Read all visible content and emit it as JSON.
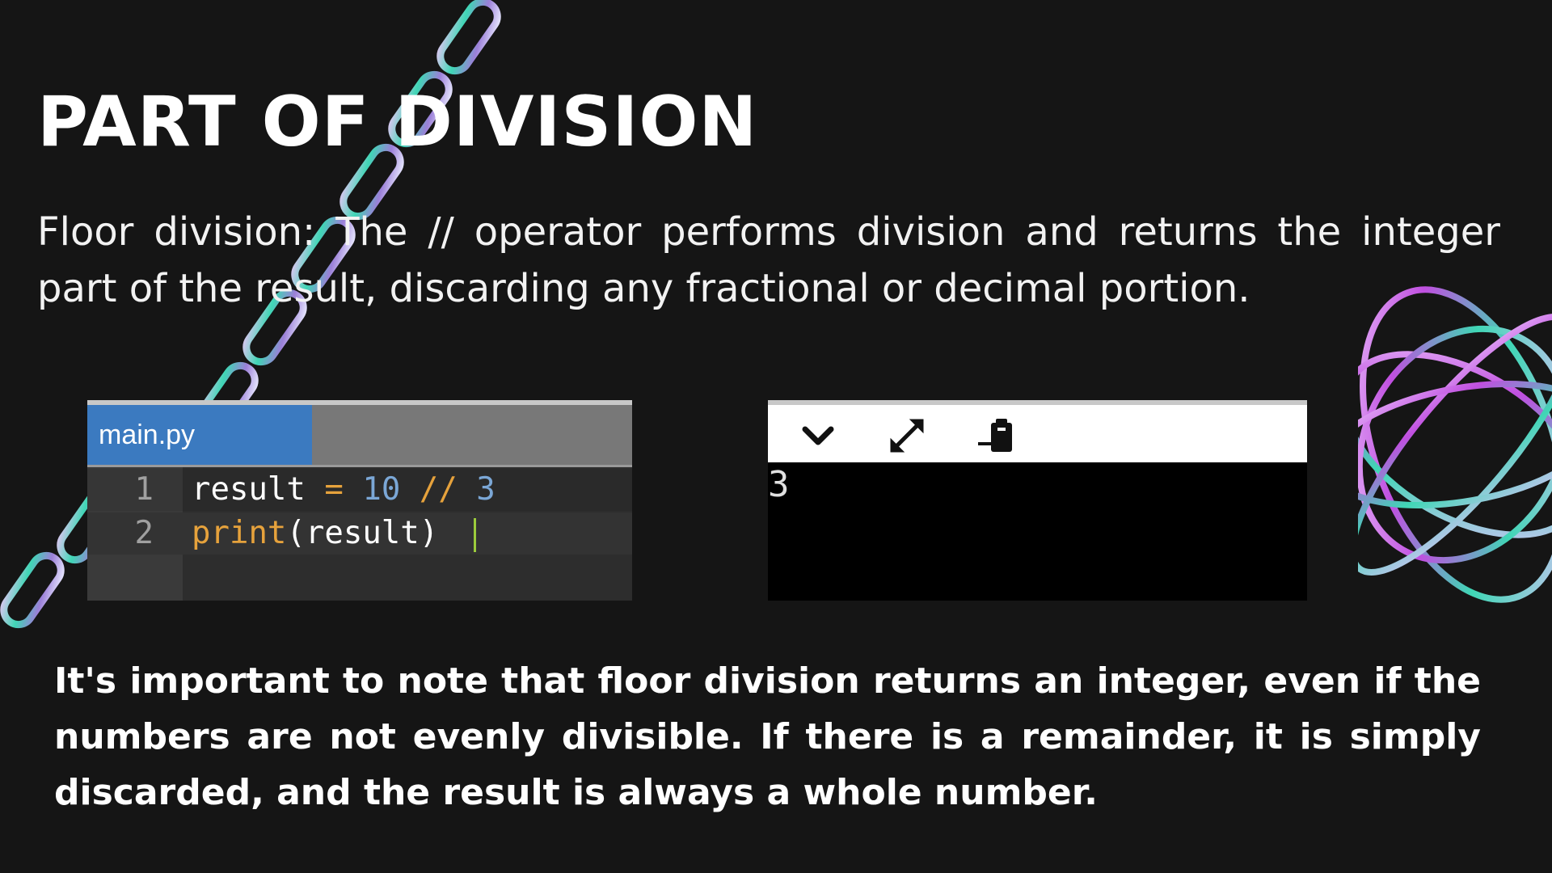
{
  "slide": {
    "title": "PART OF DIVISION",
    "subtitle": "Floor division: The // operator performs division and returns the integer part of the result, discarding any fractional or decimal portion.",
    "note": "It's important to note that floor division returns an integer, even if the numbers are not evenly divisible. If there is a remainder, it is simply discarded, and the result is always a whole number."
  },
  "editor": {
    "tab_label": "main.py",
    "lines": [
      {
        "number": "1",
        "tokens": {
          "var": "result",
          "eq": "=",
          "a": "10",
          "op": "//",
          "b": "3"
        }
      },
      {
        "number": "2",
        "tokens": {
          "fn": "print",
          "open": "(",
          "arg": "result",
          "close": ")"
        }
      }
    ]
  },
  "console": {
    "toolbar": {
      "collapse_icon": "chevron-down-icon",
      "expand_icon": "expand-arrows-icon",
      "paste_icon": "clipboard-icon"
    },
    "output": "3"
  },
  "colors": {
    "background": "#151515",
    "tab_active": "#3b7ac0",
    "operator": "#e6a23c",
    "number": "#7ba7d6",
    "cursor": "#9ccc3c"
  }
}
